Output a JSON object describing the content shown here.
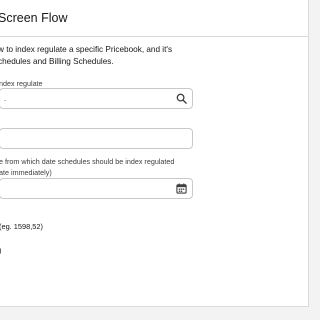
{
  "header": {
    "title": "Screen Flow"
  },
  "intro": {
    "line1": "w to index regulate a specific Pricebook, and it's",
    "line2": "chedules and Billing Schedules."
  },
  "pricebook": {
    "label": "ndex regulate",
    "value": "."
  },
  "percent": {
    "value": ""
  },
  "date": {
    "label_line1": "e from which date schedules should be index regulated",
    "label_line2": "ate immediately)"
  },
  "hint": {
    "text": "(eg. 1598,52)"
  },
  "paren": {
    "text": ")"
  }
}
